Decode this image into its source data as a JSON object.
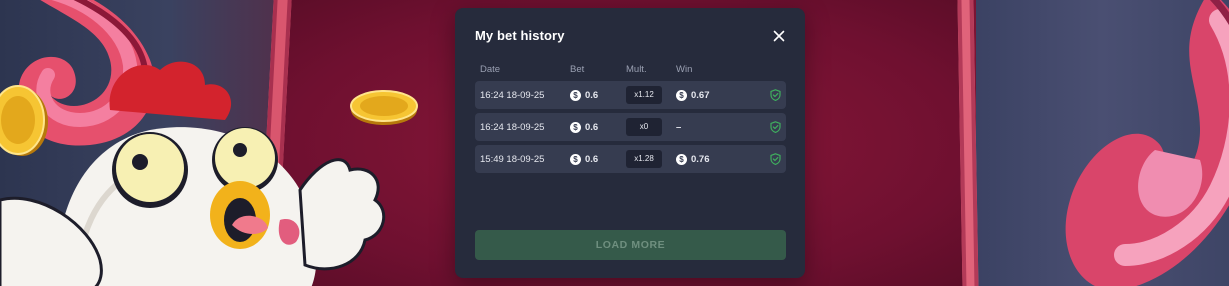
{
  "modal": {
    "title": "My bet history",
    "columns": {
      "date": "Date",
      "bet": "Bet",
      "mult": "Mult.",
      "win": "Win"
    },
    "rows": [
      {
        "date": "16:24 18-09-25",
        "bet": "0.6",
        "mult": "x1.12",
        "win": "0.67"
      },
      {
        "date": "16:24 18-09-25",
        "bet": "0.6",
        "mult": "x0",
        "win": "–"
      },
      {
        "date": "15:49 18-09-25",
        "bet": "0.6",
        "mult": "x1.28",
        "win": "0.76"
      }
    ],
    "load_more_label": "LOAD MORE"
  },
  "icons": {
    "close": "close-icon",
    "currency": "dollar-coin-icon",
    "verified": "shield-check-icon"
  },
  "colors": {
    "modal_bg": "#262b3c",
    "row_bg": "#363c50",
    "load_more_bg": "#355a4a",
    "verified_green": "#3fae5e",
    "background_crimson": "#7a1434"
  }
}
